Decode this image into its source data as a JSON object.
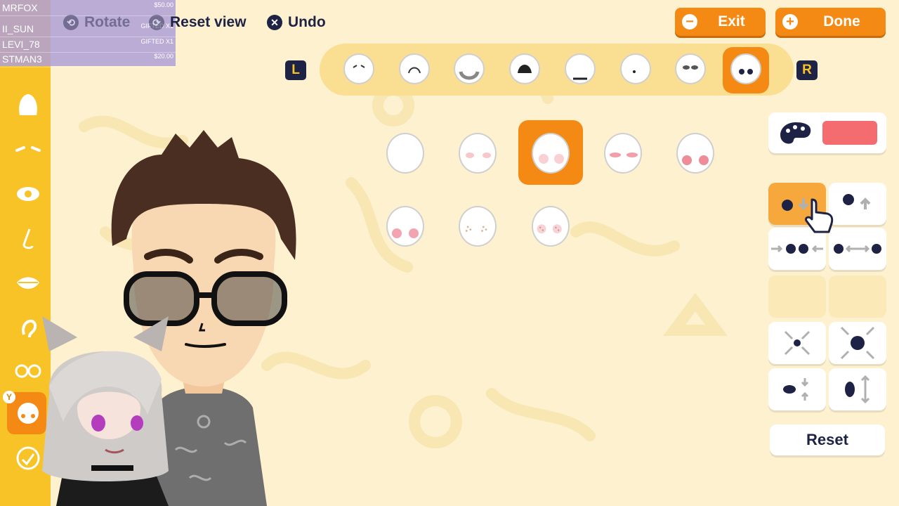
{
  "overlay": {
    "rows": [
      {
        "name": "MRFOX",
        "value": "$50.00"
      },
      {
        "name": "II_SUN",
        "value": "GIFTED X1"
      },
      {
        "name": "LEVI_78",
        "value": "GIFTED X1"
      },
      {
        "name": "STMAN3",
        "value": "$20.00"
      }
    ]
  },
  "toolbar": {
    "rotate_label": "Rotate",
    "reset_view_label": "Reset view",
    "undo_label": "Undo",
    "exit_label": "Exit",
    "done_label": "Done"
  },
  "category_bar": {
    "left_shoulder": "L",
    "right_shoulder": "R",
    "selected_index": 7
  },
  "options": {
    "selected_index": 2
  },
  "colors": {
    "accent": "#f48a14",
    "sidebar": "#f8c327",
    "background": "#fdf1cf",
    "dark": "#1e2346",
    "swatch": "#f46c6f"
  },
  "panel": {
    "reset_label": "Reset"
  }
}
